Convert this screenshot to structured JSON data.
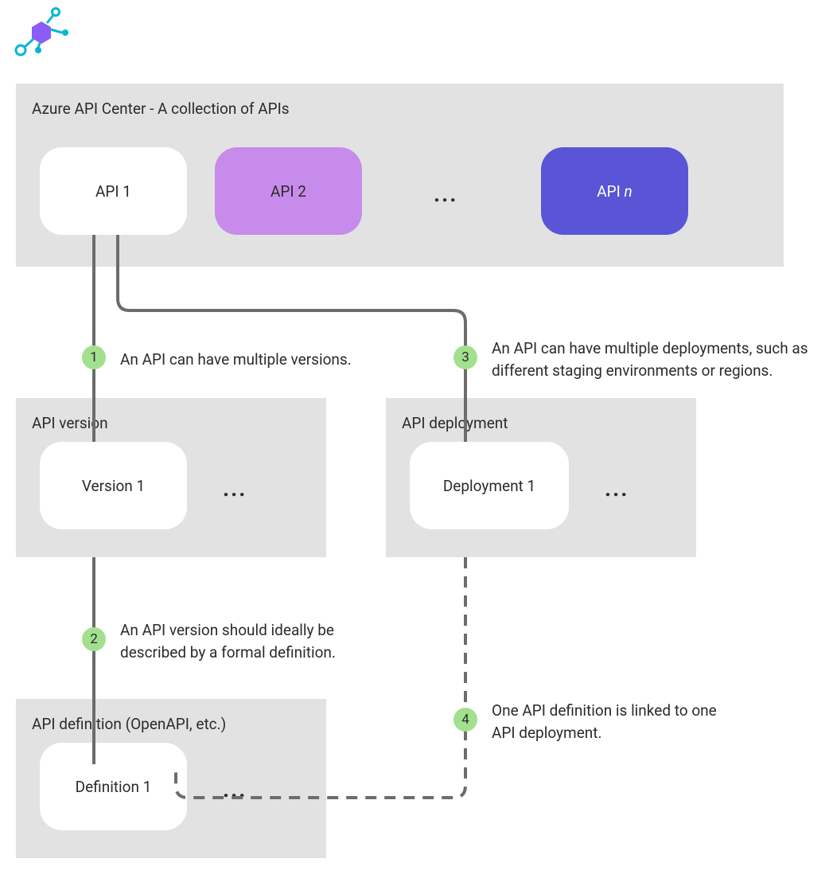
{
  "logo_name": "azure-api-center-logo",
  "top_panel": {
    "title": "Azure API Center - A collection of APIs",
    "api1": "API 1",
    "api2": "API 2",
    "dots": "...",
    "apin_prefix": "API ",
    "apin_suffix": "n"
  },
  "version_panel": {
    "title": "API version",
    "node": "Version 1",
    "dots": "..."
  },
  "deployment_panel": {
    "title": "API deployment",
    "node": "Deployment 1",
    "dots": "..."
  },
  "definition_panel": {
    "title": "API definition (OpenAPI, etc.)",
    "node": "Definition 1",
    "dots": "..."
  },
  "annotations": {
    "a1": {
      "num": "1",
      "text": "An API can have multiple versions."
    },
    "a2": {
      "num": "2",
      "text": "An API version should ideally be described by a formal definition."
    },
    "a3": {
      "num": "3",
      "text": "An API can have multiple deployments, such as different staging environments or regions."
    },
    "a4": {
      "num": "4",
      "text": "One API definition is linked to one API deployment."
    }
  }
}
